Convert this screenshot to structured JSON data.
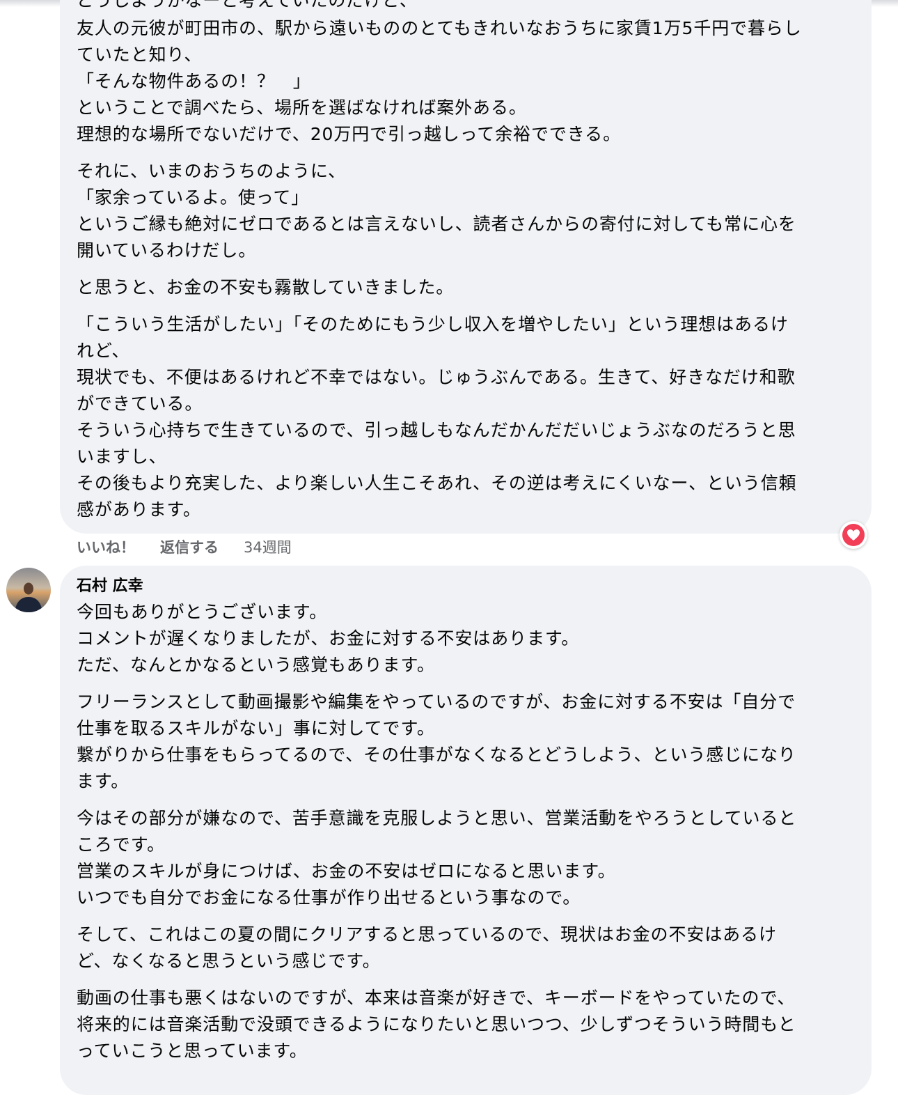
{
  "comment1": {
    "lines": [
      "どうしようかなーと考えていたのだけど、",
      "友人の元彼が町田市の、駅から遠いもののとてもきれいなおうちに家賃1万5千円で暮らし",
      "ていたと知り、",
      "「そんな物件あるの！？　」",
      "ということで調べたら、場所を選ばなければ案外ある。",
      "理想的な場所でないだけで、20万円で引っ越しって余裕でできる。",
      "それに、いまのおうちのように、",
      "「家余っているよ。使って」",
      "というご縁も絶対にゼロであるとは言えないし、読者さんからの寄付に対しても常に心を",
      "開いているわけだし。",
      "と思うと、お金の不安も霧散していきました。",
      "「こういう生活がしたい」「そのためにもう少し収入を増やしたい」という理想はあるけ",
      "れど、",
      "現状でも、不便はあるけれど不幸ではない。じゅうぶんである。生きて、好きなだけ和歌",
      "ができている。",
      "そういう心持ちで生きているので、引っ越しもなんだかんだだいじょうぶなのだろうと思",
      "いますし、",
      "その後もより充実した、より楽しい人生こそあれ、その逆は考えにくいなー、という信頼",
      "感があります。"
    ],
    "actions": {
      "like": "いいね！",
      "reply": "返信する",
      "time": "34週間"
    },
    "reaction_icon": "heart-icon",
    "reaction_color": "#f33e58"
  },
  "comment2": {
    "author": "石村 広幸",
    "lines": [
      "今回もありがとうございます。",
      "コメントが遅くなりましたが、お金に対する不安はあります。",
      "ただ、なんとかなるという感覚もあります。",
      "フリーランスとして動画撮影や編集をやっているのですが、お金に対する不安は「自分で",
      "仕事を取るスキルがない」事に対してです。",
      "繋がりから仕事をもらってるので、その仕事がなくなるとどうしよう、という感じになり",
      "ます。",
      "今はその部分が嫌なので、苦手意識を克服しようと思い、営業活動をやろうとしていると",
      "ころです。",
      "営業のスキルが身につけば、お金の不安はゼロになると思います。",
      "いつでも自分でお金になる仕事が作り出せるという事なので。",
      "そして、これはこの夏の間にクリアすると思っているので、現状はお金の不安はあるけ",
      "ど、なくなると思うという感じです。",
      "動画の仕事も悪くはないのですが、本来は音楽が好きで、キーボードをやっていたので、",
      "将来的には音楽活動で没頭できるようになりたいと思いつつ、少しずつそういう時間もと",
      "っていこうと思っています。"
    ]
  },
  "colors": {
    "bubble": "#f0f2f5",
    "text": "#050505",
    "secondary": "#65676b"
  }
}
